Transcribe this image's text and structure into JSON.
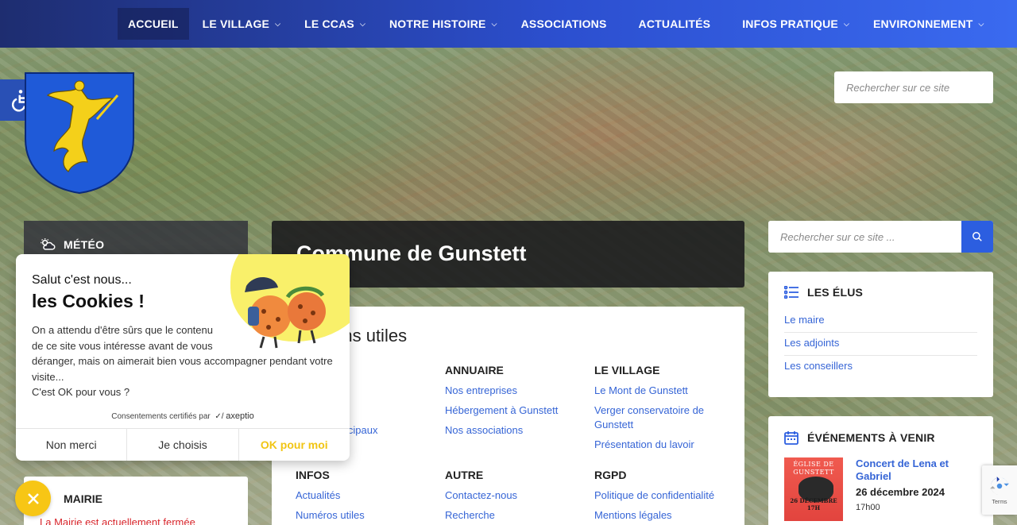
{
  "nav": {
    "items": [
      {
        "label": "ACCUEIL",
        "has_dropdown": false
      },
      {
        "label": "LE VILLAGE",
        "has_dropdown": true
      },
      {
        "label": "LE CCAS",
        "has_dropdown": true
      },
      {
        "label": "NOTRE HISTOIRE",
        "has_dropdown": true
      },
      {
        "label": "ASSOCIATIONS",
        "has_dropdown": false
      },
      {
        "label": "ACTUALITÉS",
        "has_dropdown": false
      },
      {
        "label": "INFOS PRATIQUE",
        "has_dropdown": true
      },
      {
        "label": "ENVIRONNEMENT",
        "has_dropdown": true
      }
    ],
    "active_index": 0
  },
  "accessibility": {
    "icon": "wheelchair-icon"
  },
  "crest": {
    "icon": "coat-of-arms-icon"
  },
  "search_top": {
    "placeholder": "Rechercher sur ce site"
  },
  "search_side": {
    "placeholder": "Rechercher sur ce site ..."
  },
  "meteo": {
    "title": "MÉTÉO",
    "icon": "weather-cloud-sun-icon"
  },
  "banner": {
    "title": "Commune de Gunstett"
  },
  "liens": {
    "title": "Liens utiles",
    "columns_row1": [
      {
        "heading": "",
        "links": [
          "",
          "",
          "…icipaux"
        ]
      },
      {
        "heading": "ANNUAIRE",
        "links": [
          "Nos entreprises",
          "Hébergement à Gunstett",
          "Nos associations"
        ]
      },
      {
        "heading": "LE VILLAGE",
        "links": [
          "Le Mont de Gunstett",
          "Verger conservatoire de Gunstett",
          "Présentation du lavoir"
        ]
      }
    ],
    "columns_row2": [
      {
        "heading": "INFOS",
        "links": [
          "Actualités",
          "Numéros utiles"
        ]
      },
      {
        "heading": "AUTRE",
        "links": [
          "Contactez-nous",
          "Recherche"
        ]
      },
      {
        "heading": "RGPD",
        "links": [
          "Politique de confidentialité",
          "Mentions légales"
        ]
      }
    ]
  },
  "elus": {
    "title": "LES ÉLUS",
    "items": [
      "Le maire",
      "Les adjoints",
      "Les conseillers"
    ]
  },
  "events": {
    "title": "ÉVÉNEMENTS À VENIR",
    "items": [
      {
        "name": "Concert de Lena et Gabriel",
        "date": "26 décembre 2024",
        "time": "17h00",
        "thumb_top": "ÉGLISE DE GUNSTETT",
        "thumb_bottom": "26 DÉCEMBRE 17H"
      }
    ]
  },
  "mairie": {
    "title": "MAIRIE",
    "status": "La Mairie est actuellement fermée"
  },
  "cookie": {
    "hello": "Salut c'est nous...",
    "big": "les Cookies !",
    "body_line1": "On a attendu d'être sûrs que le contenu de ce site vous intéresse avant de vous",
    "body_line2": "déranger, mais on aimerait bien vous accompagner pendant votre visite...",
    "body_line3": "C'est OK pour vous ?",
    "certified": "Consentements certifiés par",
    "brand": "axeptio",
    "btn_no": "Non merci",
    "btn_choose": "Je choisis",
    "btn_ok": "OK pour moi"
  },
  "recaptcha": {
    "terms": "Terms"
  },
  "colors": {
    "nav_start": "#1e2d70",
    "nav_end": "#3a6af0",
    "link": "#3665d6",
    "search_button": "#2c5ee0",
    "cookie_yellow": "#f7c615",
    "mairie_status": "#d8262c"
  }
}
